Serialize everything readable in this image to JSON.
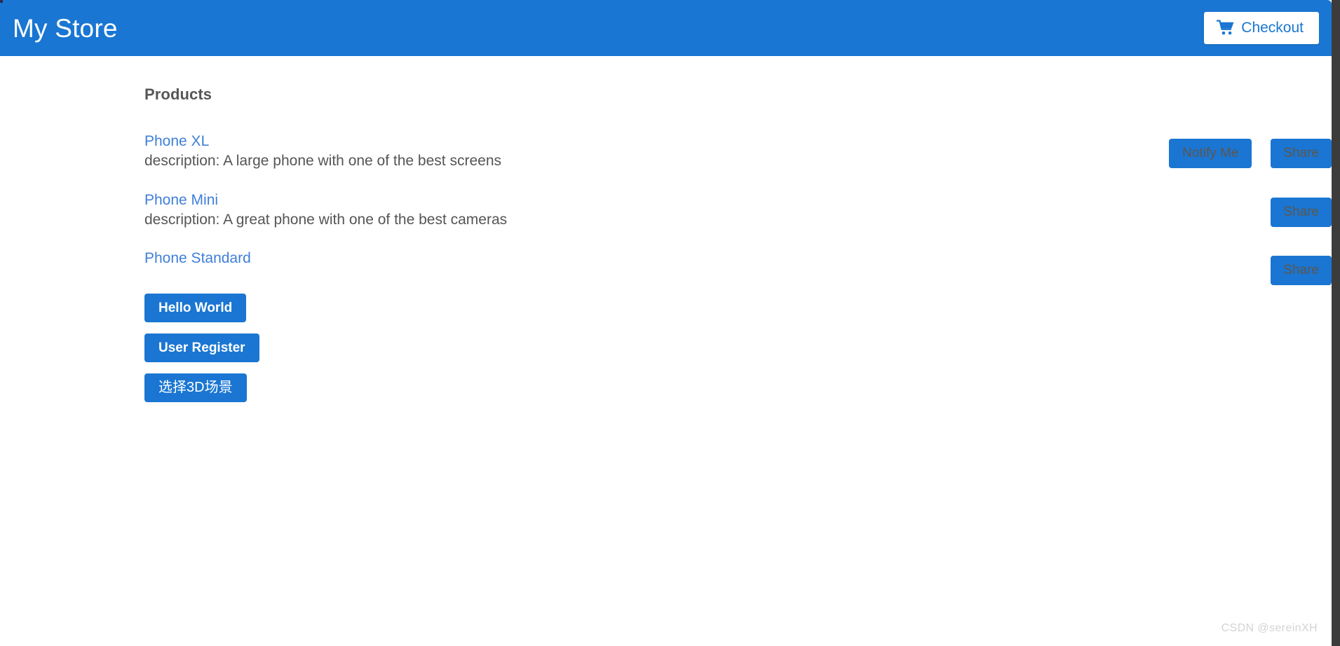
{
  "header": {
    "brand": "My Store",
    "checkout_label": "Checkout",
    "cart_icon": "shopping-cart-icon",
    "background_color": "#1976d2",
    "checkout_text_color": "#1976d2"
  },
  "main": {
    "page_title": "Products",
    "products": [
      {
        "name": "Phone XL",
        "description": "description: A large phone with one of the best screens",
        "buttons": [
          "Notify Me",
          "Share"
        ]
      },
      {
        "name": "Phone Mini",
        "description": "description: A great phone with one of the best cameras",
        "buttons": [
          "Share"
        ]
      },
      {
        "name": "Phone Standard",
        "description": "",
        "buttons": [
          "Share"
        ]
      }
    ],
    "actions": [
      {
        "label": "Hello World"
      },
      {
        "label": "User Register"
      },
      {
        "label": "选择3D场景"
      }
    ]
  },
  "watermark": {
    "text": "CSDN @sereinXH"
  },
  "colors": {
    "primary_blue": "#1976d2",
    "button_blue": "#1a76d2",
    "link_blue": "#3f7fd9",
    "text_gray": "#555555",
    "flat_button_text": "#5d564f",
    "watermark_gray": "#d3d3d3",
    "edge_strip": "#3c3c3c"
  }
}
